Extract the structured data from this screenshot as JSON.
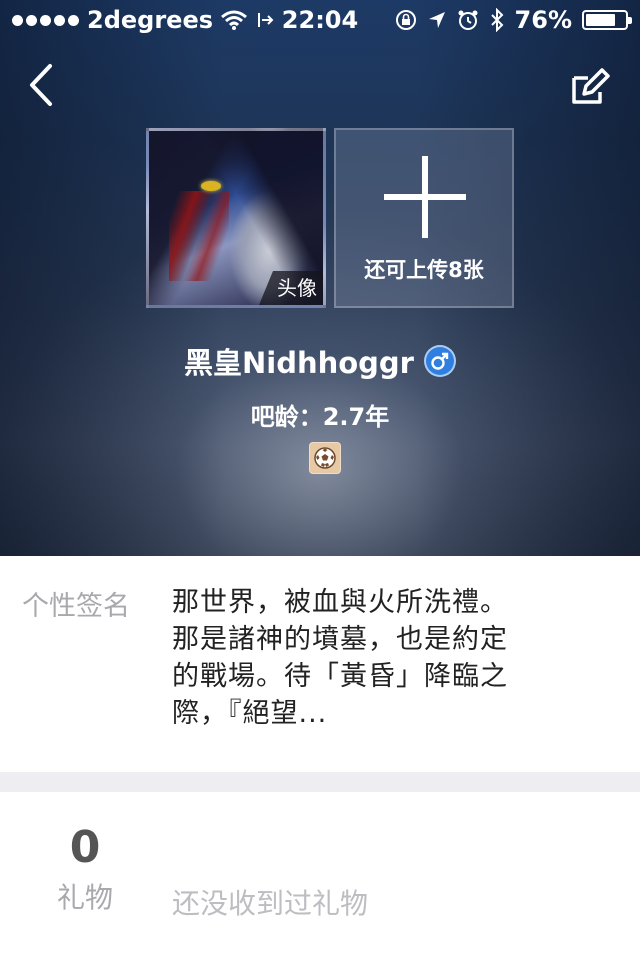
{
  "status_bar": {
    "carrier": "2degrees",
    "time": "22:04",
    "battery": "76%",
    "battery_level": 0.76
  },
  "header": {
    "back_icon": "chevron-left-icon",
    "edit_icon": "edit-icon"
  },
  "photos": {
    "avatar_tag": "头像",
    "upload_label": "还可上传8张"
  },
  "profile": {
    "name": "黑皇Nidhhoggr",
    "gender": "♂",
    "age": "吧龄：2.7年",
    "level_icon": "soccer-ball-icon"
  },
  "signature": {
    "label": "个性签名",
    "text": "那世界，被血與火所洗禮。那是諸神的墳墓，也是約定的戰場。待「黃昏」降臨之際，『絕望..."
  },
  "gifts": {
    "count": "0",
    "label": "礼物",
    "empty_text": "还没收到过礼物"
  },
  "colors": {
    "gender_badge": "#2f7fe0",
    "divider": "#eeeef2",
    "muted_text": "#a9a9ad"
  }
}
